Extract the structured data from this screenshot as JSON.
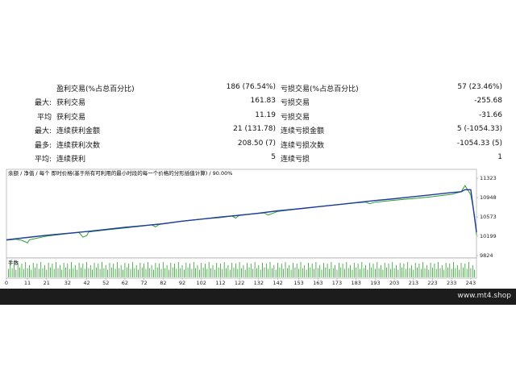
{
  "stats": {
    "rows": [
      {
        "prefix": "",
        "label1": "盈利交易(%占总百分比)",
        "val1": "186 (76.54%)",
        "label2": "亏损交易(%占总百分比)",
        "val2": "57 (23.46%)"
      },
      {
        "prefix": "最大:",
        "label1": "获利交易",
        "val1": "161.83",
        "label2": "亏损交易",
        "val2": "-255.68"
      },
      {
        "prefix": "平均",
        "label1": "获利交易",
        "val1": "11.19",
        "label2": "亏损交易",
        "val2": "-31.66"
      },
      {
        "prefix": "最大:",
        "label1": "连续获利金额",
        "val1": "21 (131.78)",
        "label2": "连续亏损金额",
        "val2": "5 (-1054.33)"
      },
      {
        "prefix": "最多:",
        "label1": "连续获利次数",
        "val1": "208.50 (7)",
        "label2": "连续亏损次数",
        "val2": "-1054.33 (5)"
      },
      {
        "prefix": "平均:",
        "label1": "连续获利",
        "val1": "5",
        "label2": "连续亏损",
        "val2": "1"
      }
    ]
  },
  "chart_data": {
    "type": "line",
    "title": "余额 / 净值 / 每个 即时价格(基于所有可利用的最小时段的每一个价格的分形插值计算) / 90.00%",
    "series": [
      {
        "name": "余额",
        "color": "#1e3a9e"
      },
      {
        "name": "净值",
        "color": "#2aa02a"
      }
    ],
    "ylim": [
      9824,
      11323
    ],
    "yticks": [
      "11323",
      "10948",
      "10573",
      "10199",
      "9824"
    ],
    "xlim": [
      0,
      246
    ],
    "xticks": [
      "0",
      "11",
      "21",
      "32",
      "42",
      "52",
      "62",
      "72",
      "82",
      "92",
      "102",
      "112",
      "122",
      "132",
      "142",
      "153",
      "163",
      "173",
      "183",
      "193",
      "203",
      "213",
      "223",
      "233",
      "243"
    ],
    "balance_x": [
      0,
      5,
      11,
      21,
      32,
      42,
      52,
      62,
      72,
      82,
      92,
      102,
      112,
      122,
      132,
      142,
      153,
      163,
      173,
      183,
      193,
      203,
      213,
      223,
      233,
      238,
      240,
      243,
      246
    ],
    "balance_y": [
      10130,
      10150,
      10175,
      10218,
      10255,
      10290,
      10330,
      10370,
      10405,
      10440,
      10490,
      10530,
      10570,
      10605,
      10645,
      10690,
      10730,
      10770,
      10810,
      10850,
      10890,
      10925,
      10965,
      11005,
      11045,
      11060,
      11100,
      11100,
      10280
    ],
    "equity_x": [
      0,
      5,
      8,
      11,
      12,
      21,
      32,
      38,
      40,
      42,
      43,
      52,
      62,
      72,
      76,
      78,
      80,
      82,
      92,
      102,
      112,
      118,
      120,
      122,
      132,
      135,
      137,
      142,
      153,
      163,
      173,
      183,
      188,
      190,
      193,
      203,
      213,
      223,
      233,
      238,
      240,
      243,
      245,
      246
    ],
    "equity_y": [
      10120,
      10140,
      10120,
      10070,
      10130,
      10200,
      10250,
      10270,
      10180,
      10210,
      10280,
      10320,
      10360,
      10400,
      10420,
      10380,
      10430,
      10440,
      10490,
      10530,
      10560,
      10590,
      10550,
      10610,
      10640,
      10650,
      10610,
      10680,
      10730,
      10770,
      10810,
      10845,
      10860,
      10830,
      10860,
      10895,
      10930,
      10965,
      11010,
      11060,
      11180,
      11000,
      10600,
      10220
    ],
    "volume_label": "手数",
    "volume_pattern": [
      0.9,
      0.55,
      1.0,
      0.6,
      0.8,
      0.5,
      0.95,
      0.65
    ]
  },
  "footer": {
    "url": "www.mt4.shop"
  }
}
